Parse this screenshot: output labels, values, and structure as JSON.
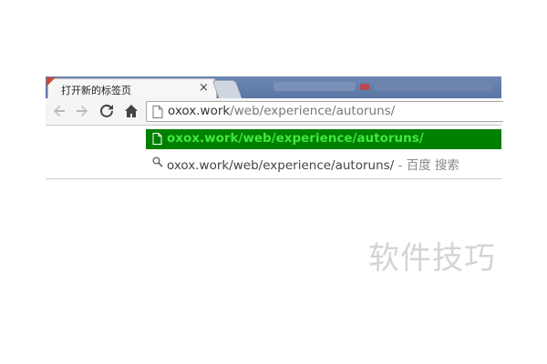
{
  "tab": {
    "title": "打开新的标签页",
    "close": "×"
  },
  "toolbar": {
    "back_icon": "back-arrow-icon",
    "forward_icon": "forward-arrow-icon",
    "reload_icon": "reload-icon",
    "home_icon": "home-icon"
  },
  "omnibox": {
    "host": "oxox.work",
    "path": "/web/experience/autoruns/"
  },
  "suggestions": [
    {
      "text": "oxox.work/web/experience/autoruns/",
      "icon": "page-icon"
    },
    {
      "text": "oxox.work/web/experience/autoruns/",
      "suffix": " - 百度 搜索",
      "icon": "search-icon"
    }
  ],
  "watermark": "软件技巧",
  "colors": {
    "highlight_bg": "#008000",
    "highlight_text": "#3fe83f",
    "tabstrip": "#6d88b4"
  }
}
